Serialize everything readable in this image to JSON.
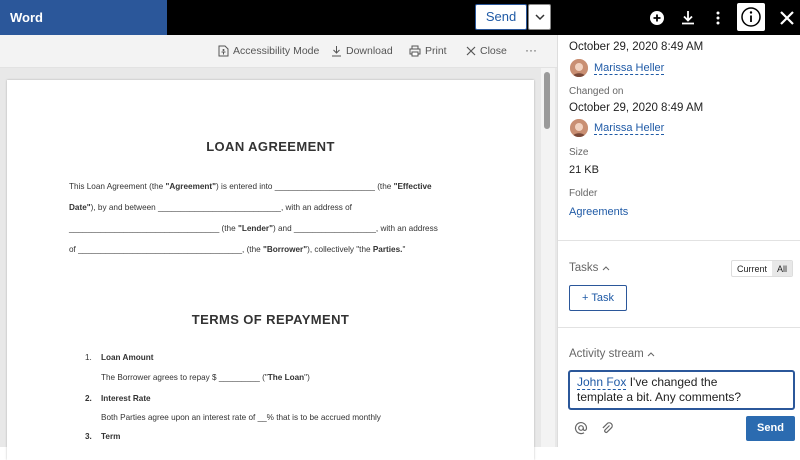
{
  "app": {
    "title": "Word"
  },
  "top": {
    "send_label": "Send"
  },
  "toolbar": {
    "accessibility_label": "Accessibility Mode",
    "download_label": "Download",
    "print_label": "Print",
    "close_label": "Close",
    "more_label": "···"
  },
  "document": {
    "title": "LOAN AGREEMENT",
    "para1_l1_a": "This Loan Agreement (the ",
    "para1_l1_b": "\"Agreement\"",
    "para1_l1_c": ") is entered into ______________________ (the ",
    "para1_l1_d": "\"Effective",
    "para1_l2_a": "Date\"",
    "para1_l2_b": "), by and  between ___________________________, with an address of",
    "para1_l3_a": "_________________________________ (the ",
    "para1_l3_b": "\"Lender\"",
    "para1_l3_c": ") and __________________, with an address",
    "para1_l4_a": "of ____________________________________, (the ",
    "para1_l4_b": "\"Borrower\"",
    "para1_l4_c": "), collectively \"the ",
    "para1_l4_d": "Parties.",
    "para1_l4_e": "\"",
    "section_title": "TERMS OF REPAYMENT",
    "items": [
      {
        "num": "1.",
        "title": "Loan Amount",
        "body_a": "The Borrower agrees to repay   $ _________ (\"",
        "body_b": "The Loan",
        "body_c": "\")"
      },
      {
        "num": "2.",
        "title": "Interest Rate",
        "body": "Both Parties agree upon an interest rate of __% that is to be accrued monthly"
      },
      {
        "num": "3.",
        "title": "Term"
      }
    ]
  },
  "sidebar": {
    "created_date": "October 29, 2020 8:49 AM",
    "created_by": "Marissa Heller",
    "changed_label": "Changed on",
    "changed_date": "October 29, 2020 8:49 AM",
    "changed_by": "Marissa Heller",
    "size_label": "Size",
    "size_value": "21 KB",
    "folder_label": "Folder",
    "folder_value": "Agreements",
    "tasks_label": "Tasks",
    "tasks_toggle": [
      "Current",
      "All"
    ],
    "task_button": "+ Task",
    "activity_label": "Activity stream",
    "comment_mention": "John Fox",
    "comment_text_1": " I've changed the",
    "comment_text_2": "template a bit. Any comments?",
    "send_label": "Send"
  },
  "icons": {
    "add": "plus-circle-icon",
    "download": "download-icon",
    "more": "more-vertical-icon",
    "info": "info-icon",
    "close": "close-icon",
    "mention": "at-icon",
    "attach": "paperclip-icon"
  },
  "colors": {
    "word_blue": "#2b579a",
    "link_blue": "#1f5aa6"
  }
}
